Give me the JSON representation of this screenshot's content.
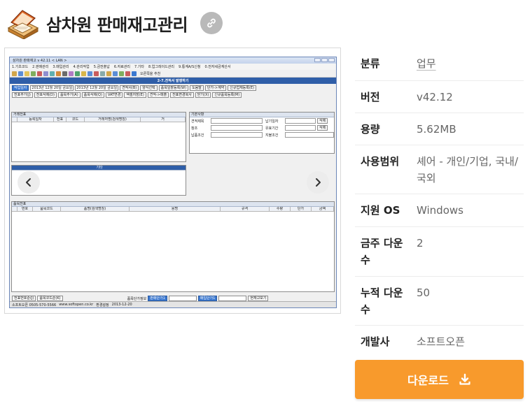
{
  "app": {
    "title": "삼차원 판매재고관리",
    "icon": "laptop-box-icon",
    "link_icon": "link-icon"
  },
  "screenshot": {
    "window_title": "삼차원 판매재고 v 42.11 < LAN >",
    "menu": [
      "1.기초코드",
      "2.판매관리",
      "3.매입관리",
      "4.관리작업",
      "5.금전출납",
      "6.자료관리",
      "7.기타",
      "8.업그레이드관리",
      "9.통계A/S신청",
      "0.전자세금계산서"
    ],
    "toolbar_text": "오른쪽을 추천",
    "section_title": "2-7.견적서 발행하기",
    "row1": {
      "period_label": "작업일자",
      "date_from": "2013년 12월 20일 금요일",
      "date_to": "2013년 12월 20일 금요일",
      "buttons": [
        "견적서(B)",
        "양식선택",
        "품목일괄등록(W)",
        "도움말",
        "단가->계약",
        "신규업체등록(E)"
      ]
    },
    "row2": {
      "buttons": [
        "전표추가(J)",
        "전표삭제(D)",
        "품목추가(A)",
        "품목삭제(Q)",
        "VAT변경",
        "엑셀저장(E)",
        "견적->매출",
        "전표변경복사",
        "닫기(X)",
        "신규품목등록(M)"
      ]
    },
    "panel_trade": {
      "title": "거래전표",
      "columns": [
        "등록일자",
        "전표",
        "코드",
        "거래처명(검색명칭)",
        "거"
      ]
    },
    "panel_basic": {
      "title": "기본사항",
      "fields": [
        "견적제목",
        "참조",
        "납품조건",
        "납기일자",
        "유효기간",
        "지불조건"
      ],
      "action": "삭제"
    },
    "panel_other": {
      "title": "기타"
    },
    "panel_items": {
      "title": "품목전표",
      "columns": [
        "번호",
        "품목코드",
        "품명(검색명칭)",
        "용명",
        "규격",
        "수량",
        "단가",
        "금액"
      ]
    },
    "tabs": [
      "전표번호순(J)",
      "품목코드순(K)"
    ],
    "price_info": "품목단가정보",
    "sale_price": "판매단가1",
    "buy_price": "매입단가1",
    "stock_btn": "현재고보기",
    "status": {
      "support": "소프트오픈 0505-570-5566",
      "site": "www.softopen.co.kr",
      "env": "환경설정",
      "date": "2013-12-20"
    }
  },
  "info": {
    "rows": [
      {
        "label": "분류",
        "value": "업무",
        "link": true
      },
      {
        "label": "버전",
        "value": "v42.12",
        "link": false
      },
      {
        "label": "용량",
        "value": "5.62MB",
        "link": false
      },
      {
        "label": "사용범위",
        "value": "셰어 - 개인/기업, 국내/국외",
        "link": false
      },
      {
        "label": "지원 OS",
        "value": "Windows",
        "link": false
      },
      {
        "label": "금주 다운수",
        "value": "2",
        "link": false
      },
      {
        "label": "누적 다운수",
        "value": "50",
        "link": false
      },
      {
        "label": "개발사",
        "value": "소프트오픈",
        "link": false
      }
    ]
  },
  "download": {
    "label": "다운로드",
    "icon": "download-icon"
  },
  "colors": {
    "download_bg": "#f89a2c",
    "header_blue": "#2f5ea8"
  }
}
